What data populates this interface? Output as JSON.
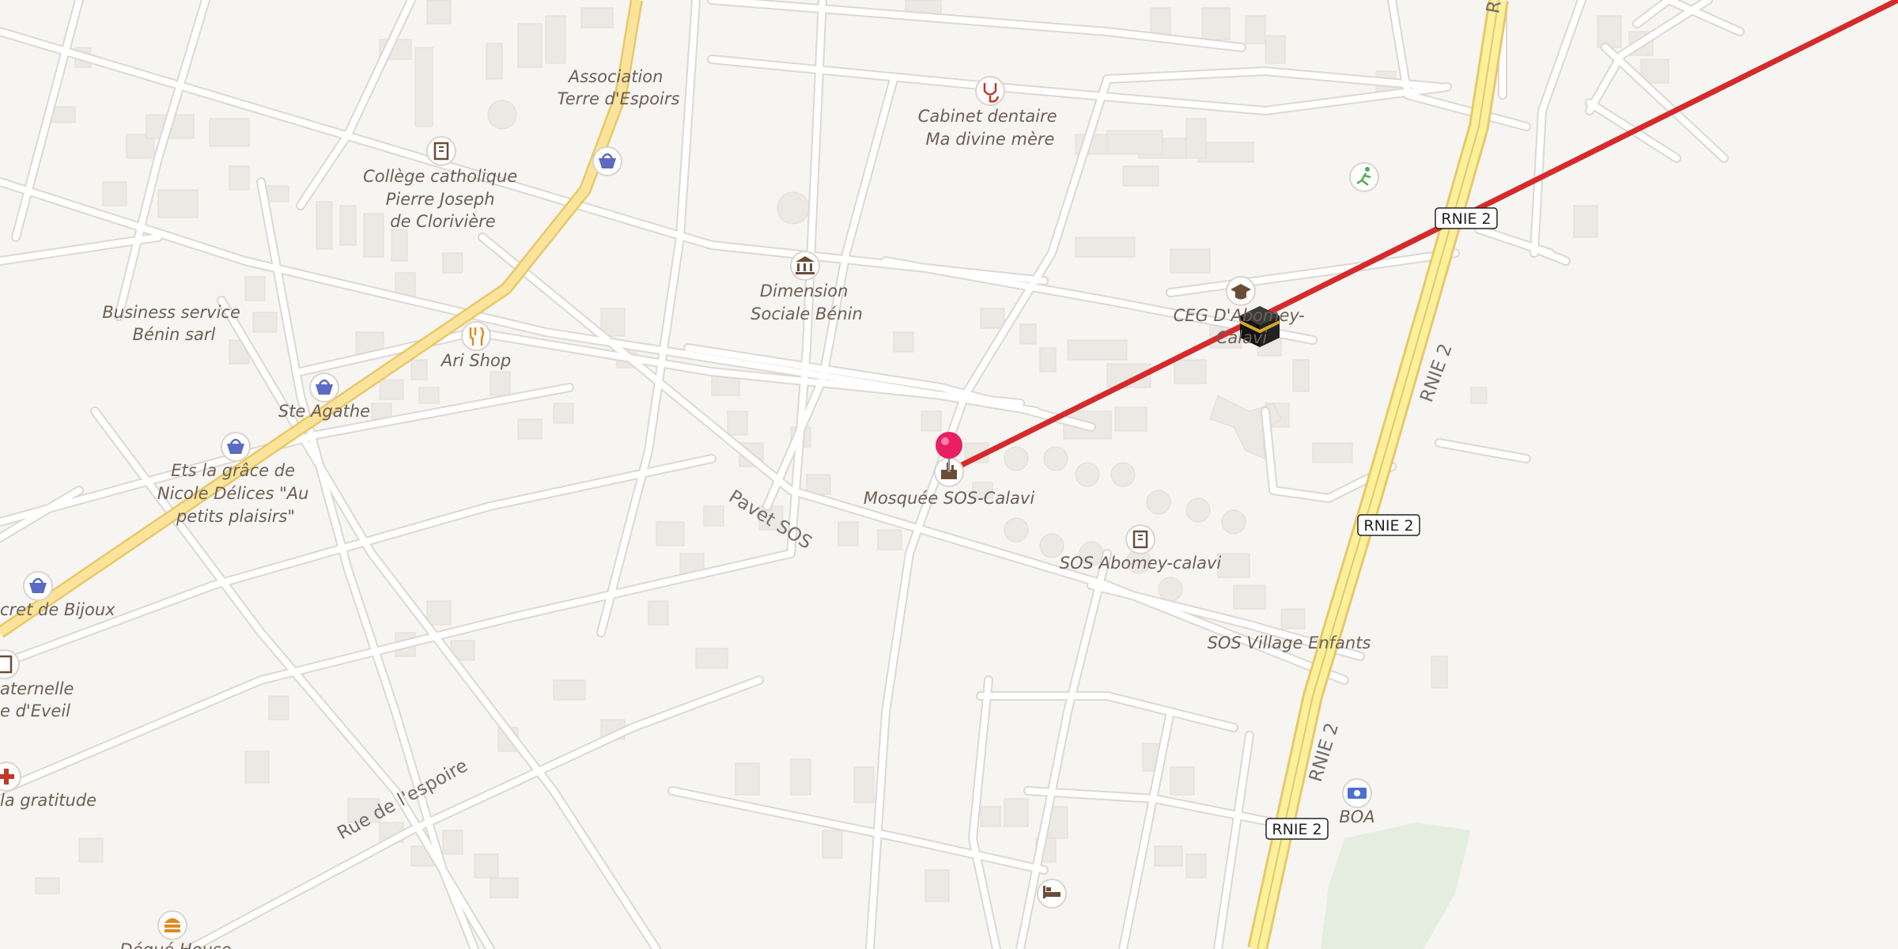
{
  "map": {
    "colors": {
      "background": "#f7f5f2",
      "building": "#ece9e5",
      "minor_road": "#ffffff",
      "road_casing": "#dcd8d3",
      "primary_road": "#fbe49a",
      "primary_casing": "#e8c86a",
      "trunk_road": "#fdf09a",
      "route_line": "#d62a2a",
      "pin": "#e91e63",
      "park": "#e4eee0"
    },
    "pois": [
      {
        "id": "association",
        "label_lines": [
          "Association",
          "Terre d'Espoirs"
        ],
        "icon": "none"
      },
      {
        "id": "cabinet-dentaire",
        "label_lines": [
          "Cabinet dentaire",
          "Ma divine mère"
        ],
        "icon": "stethoscope-icon"
      },
      {
        "id": "college",
        "label_lines": [
          "Collège catholique",
          "Pierre Joseph",
          "de Clorivière"
        ],
        "icon": "school-icon"
      },
      {
        "id": "shop-basket-1",
        "label_lines": [],
        "icon": "shop-basket-icon"
      },
      {
        "id": "dimension-sociale",
        "label_lines": [
          "Dimension",
          "Sociale Bénin"
        ],
        "icon": "townhall-icon"
      },
      {
        "id": "business-service",
        "label_lines": [
          "Business service",
          "Bénin sarl"
        ],
        "icon": "none"
      },
      {
        "id": "ari-shop",
        "label_lines": [
          "Ari Shop"
        ],
        "icon": "restaurant-icon"
      },
      {
        "id": "ste-agathe",
        "label_lines": [
          "Ste Agathe"
        ],
        "icon": "shop-basket-icon"
      },
      {
        "id": "ets-la-grace",
        "label_lines": [
          "Ets la grâce de",
          "Nicole Délices \"Au",
          "petits plaisirs\""
        ],
        "icon": "shop-basket-icon"
      },
      {
        "id": "secret-bijoux",
        "label_lines": [
          "cret de Bijoux"
        ],
        "icon": "shop-basket-icon"
      },
      {
        "id": "maternelle",
        "label_lines": [
          "aternelle",
          "e d'Eveil"
        ],
        "icon": "school-icon"
      },
      {
        "id": "la-gratitude",
        "label_lines": [
          "la gratitude"
        ],
        "icon": "pharmacy-cross-icon"
      },
      {
        "id": "degue-house",
        "label_lines": [
          "Dégué House"
        ],
        "icon": "fast-food-icon"
      },
      {
        "id": "ceg",
        "label_lines": [
          "CEG D'Abomey-",
          "Calavi"
        ],
        "icon": "graduation-cap-icon"
      },
      {
        "id": "mosquee",
        "label_lines": [
          "Mosquée SOS-Calavi"
        ],
        "icon": "mosque-icon"
      },
      {
        "id": "sos-abomey",
        "label_lines": [
          "SOS Abomey-calavi"
        ],
        "icon": "school-icon"
      },
      {
        "id": "sos-village",
        "label_lines": [
          "SOS Village Enfants"
        ],
        "icon": "none"
      },
      {
        "id": "boa",
        "label_lines": [
          "BOA"
        ],
        "icon": "bank-note-icon"
      },
      {
        "id": "sport",
        "label_lines": [],
        "icon": "running-person-icon"
      },
      {
        "id": "hotel",
        "label_lines": [],
        "icon": "bed-icon"
      }
    ],
    "road_labels": {
      "pavet_sos": "Pavet SOS",
      "rue_espoire": "Rue de l'espoire",
      "rnie2_vertical_1": "RNIE 2",
      "rnie2_vertical_2": "RNIE 2",
      "rnie2_top_fragment": "R"
    },
    "shields": {
      "rnie2_a": "RNIE 2",
      "rnie2_b": "RNIE 2",
      "rnie2_c": "RNIE 2"
    },
    "markers": {
      "pin": "location-pin-icon",
      "kaaba": "kaaba-icon"
    }
  }
}
